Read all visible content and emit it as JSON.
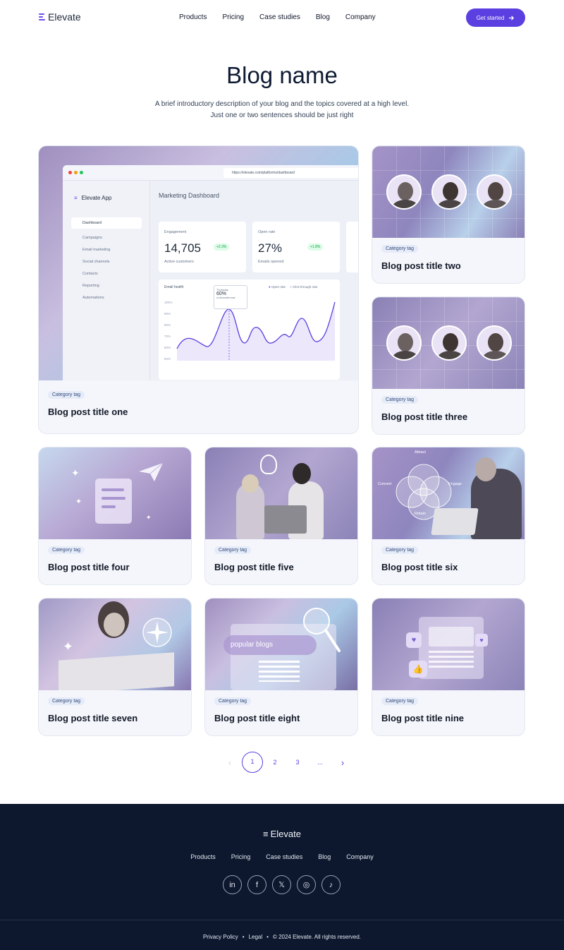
{
  "brand": {
    "name": "Elevate",
    "accent": "#5b3fe0",
    "footer_bg": "#0d172e"
  },
  "nav": {
    "links": [
      "Products",
      "Pricing",
      "Case studies",
      "Blog",
      "Company"
    ],
    "cta": "Get started",
    "cta_icon": "arrow-right-icon"
  },
  "hero": {
    "title": "Blog name",
    "desc_line1": "A brief introductory description of your blog and the topics covered at a high level.",
    "desc_line2": "Just one or two sentences should be just right"
  },
  "dashboard": {
    "url": "https://elevate.com/platforms/dashboard",
    "app_name": "Elevate App",
    "menu": [
      "Dashboard",
      "Campaigns",
      "Email marketing",
      "Social channels",
      "Contacts",
      "Reporting",
      "Automations"
    ],
    "header": "Marketing Dashboard",
    "stat1": {
      "label": "Engagement",
      "value": "14,705",
      "delta": "+2.3%",
      "sub": "Active customers"
    },
    "stat2": {
      "label": "Open rate",
      "value": "27%",
      "delta": "+1.8%",
      "sub": "Emails opened"
    },
    "chart": {
      "title": "Email health",
      "legend1": "Open rate",
      "legend2": "Click through rate",
      "tooltip_day": "Thursday",
      "tooltip_value": "60%",
      "tooltip_sub": "of all emails read",
      "yticks": [
        "100%",
        "90%",
        "80%",
        "70%",
        "60%",
        "50%"
      ]
    }
  },
  "posts": [
    {
      "tag": "Category tag",
      "title": "Blog post title one"
    },
    {
      "tag": "Category tag",
      "title": "Blog post title two"
    },
    {
      "tag": "Category tag",
      "title": "Blog post title three"
    },
    {
      "tag": "Category tag",
      "title": "Blog post title four"
    },
    {
      "tag": "Category tag",
      "title": "Blog post title five"
    },
    {
      "tag": "Category tag",
      "title": "Blog post title six"
    },
    {
      "tag": "Category tag",
      "title": "Blog post title seven"
    },
    {
      "tag": "Category tag",
      "title": "Blog post title eight"
    },
    {
      "tag": "Category tag",
      "title": "Blog post title nine"
    }
  ],
  "venn": {
    "top": "Attract",
    "left": "Convert",
    "right": "Engage",
    "bottom": "Retain"
  },
  "search_text": "popular blogs",
  "pagination": {
    "prev": "‹",
    "pages": [
      "1",
      "2",
      "3",
      "..."
    ],
    "next": "›",
    "current": "1"
  },
  "footer": {
    "logo": "Elevate",
    "links": [
      "Products",
      "Pricing",
      "Case studies",
      "Blog",
      "Company"
    ],
    "social": [
      "in",
      "f",
      "𝕏",
      "◎",
      "♪"
    ],
    "privacy": "Privacy Policy",
    "legal": "Legal",
    "dot": "•",
    "copyright": "© 2024 Elevate. All rights reserved."
  }
}
